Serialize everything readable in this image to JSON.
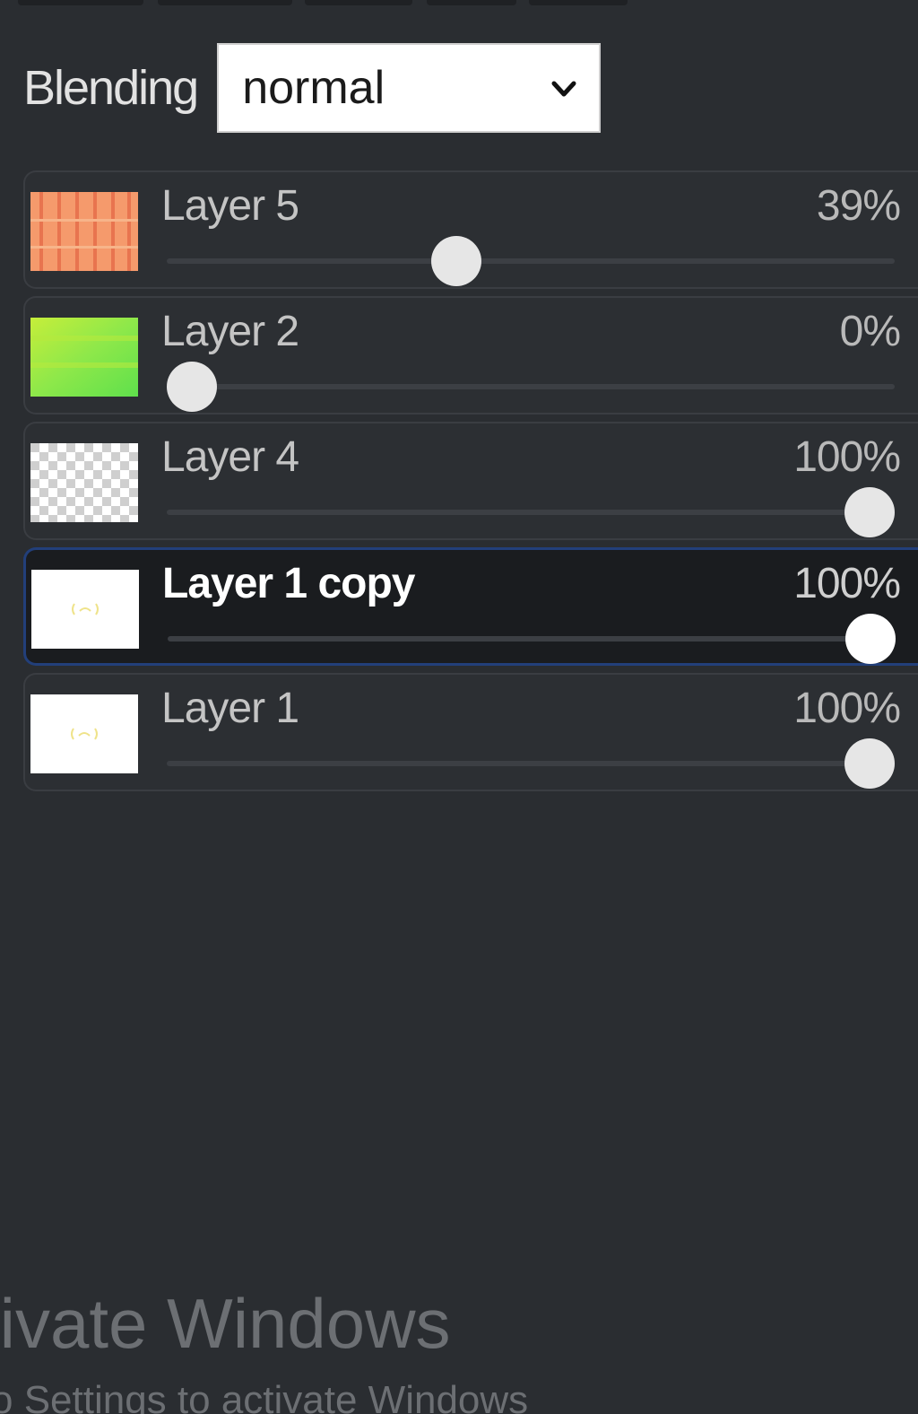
{
  "blending": {
    "label": "Blending",
    "selected": "normal"
  },
  "layers": [
    {
      "name": "Layer 5",
      "opacity_label": "39%",
      "opacity": 0.39,
      "thumb": "orange-stripes",
      "selected": false
    },
    {
      "name": "Layer 2",
      "opacity_label": "0%",
      "opacity": 0.0,
      "thumb": "green-gradient",
      "selected": false
    },
    {
      "name": "Layer 4",
      "opacity_label": "100%",
      "opacity": 1.0,
      "thumb": "transparent-checker",
      "selected": false
    },
    {
      "name": "Layer 1 copy",
      "opacity_label": "100%",
      "opacity": 1.0,
      "thumb": "white-smiley",
      "selected": true
    },
    {
      "name": "Layer 1",
      "opacity_label": "100%",
      "opacity": 1.0,
      "thumb": "white-smiley",
      "selected": false
    }
  ],
  "watermark": {
    "title": "tivate Windows",
    "subtitle": "o Settings to activate Windows"
  },
  "colors": {
    "panel_bg": "#2a2d31",
    "selected_border": "#223f7a"
  }
}
